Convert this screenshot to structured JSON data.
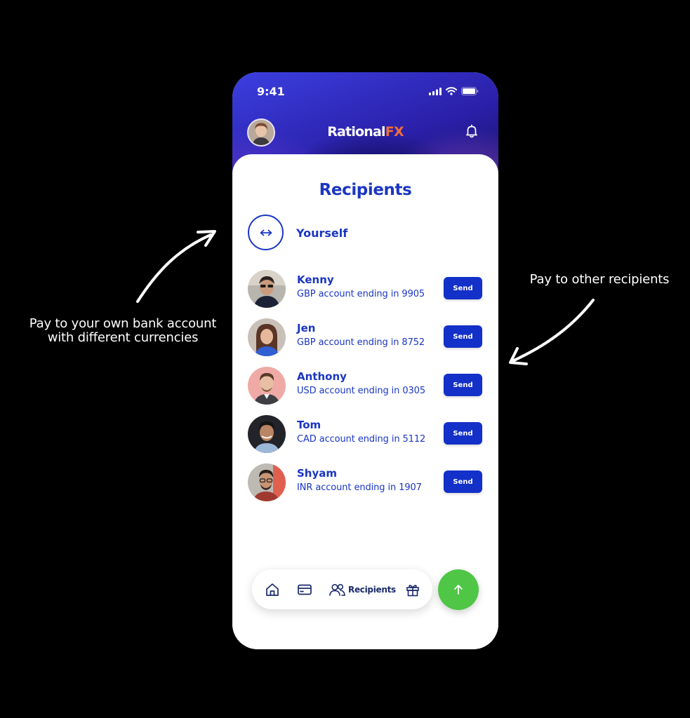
{
  "annotations": {
    "left_line1": "Pay to your own bank account",
    "left_line2": "with different currencies",
    "right": "Pay to other recipients"
  },
  "status_bar": {
    "time": "9:41"
  },
  "header": {
    "brand_part1": "Rational",
    "brand_part2": "FX",
    "brand_accent_color": "#f06e3a"
  },
  "page": {
    "title": "Recipients"
  },
  "yourself": {
    "label": "Yourself"
  },
  "recipients": [
    {
      "name": "Kenny",
      "account": "GBP account ending in 9905",
      "action": "Send"
    },
    {
      "name": "Jen",
      "account": "GBP account ending in 8752",
      "action": "Send"
    },
    {
      "name": "Anthony",
      "account": "USD account ending in 0305",
      "action": "Send"
    },
    {
      "name": "Tom",
      "account": "CAD account ending in 5112",
      "action": "Send"
    },
    {
      "name": "Shyam",
      "account": "INR account ending in 1907",
      "action": "Send"
    }
  ],
  "bottom_nav": {
    "items": [
      {
        "icon": "home-icon"
      },
      {
        "icon": "card-icon"
      },
      {
        "icon": "people-icon",
        "label": "Recipients",
        "active": true
      },
      {
        "icon": "gift-icon"
      }
    ],
    "fab_icon": "arrow-up-icon"
  },
  "colors": {
    "primary_blue": "#1b36c2",
    "send_button": "#1330c8",
    "fab_green": "#4fc646",
    "background": "#000000"
  }
}
